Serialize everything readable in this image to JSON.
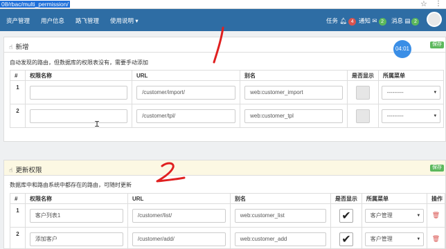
{
  "browser": {
    "url": "08/rbac/multi_permission/"
  },
  "nav": {
    "items": [
      "资产管理",
      "用户信息",
      "路飞管理",
      "使用说明 ▾"
    ],
    "task_label": "任务",
    "task_count": "4",
    "notify_label": "通知",
    "notify_count": "2",
    "msg_label": "消息",
    "msg_count": "2"
  },
  "add_panel": {
    "title": "新增",
    "save_label": "保存",
    "note": "自动发现的路由，但数据库的权限表没有，需要手动添加",
    "headers": [
      "#",
      "权限名称",
      "URL",
      "别名",
      "是否显示",
      "所属菜单"
    ],
    "rows": [
      {
        "num": "1",
        "name": "",
        "url": "/customer/import/",
        "alias": "web:customer_import",
        "menu": "---------"
      },
      {
        "num": "2",
        "name": "",
        "url": "/customer/tpl/",
        "alias": "web:customer_tpl",
        "menu": "---------"
      }
    ]
  },
  "update_panel": {
    "title": "更新权限",
    "save_label": "保存",
    "note": "数据库中和路由系统中都存在的路由，可随时更新",
    "headers": [
      "#",
      "权限名称",
      "URL",
      "别名",
      "是否显示",
      "所属菜单",
      "操作"
    ],
    "rows": [
      {
        "num": "1",
        "name": "客户列表1",
        "url": "/customer/list/",
        "alias": "web:customer_list",
        "menu": "客户管理"
      },
      {
        "num": "2",
        "name": "添加客户",
        "url": "/customer/add/",
        "alias": "web:customer_add",
        "menu": "客户管理"
      }
    ]
  },
  "clock": "04:01",
  "colors": {
    "navbar": "#2e6da4",
    "save": "#5cb85c",
    "task_badge": "#d9534f",
    "notify_badge": "#5cb85c",
    "msg_badge": "#5cb85c",
    "annotation": "#e02020"
  }
}
